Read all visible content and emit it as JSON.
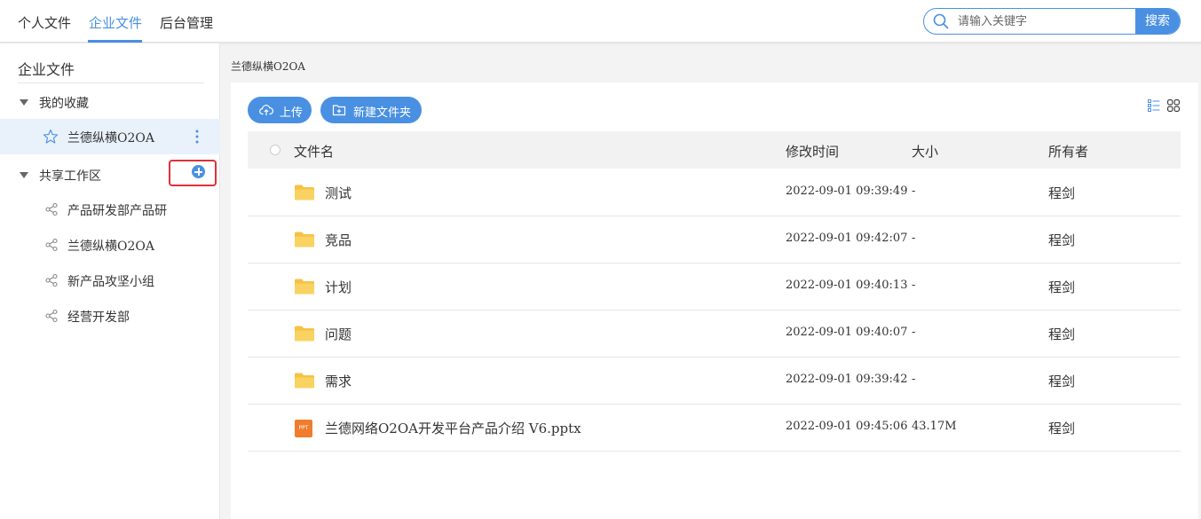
{
  "top_nav": {
    "tabs": [
      {
        "label": "个人文件",
        "active": false
      },
      {
        "label": "企业文件",
        "active": true
      },
      {
        "label": "后台管理",
        "active": false
      }
    ],
    "search": {
      "placeholder": "请输入关键字",
      "value": "",
      "button_label": "搜索"
    },
    "accent_color": "#4a90e2"
  },
  "sidebar": {
    "title": "企业文件",
    "favorites": {
      "label": "我的收藏",
      "items": [
        {
          "label": "兰德纵横O2OA",
          "icon": "star-icon",
          "selected": true
        }
      ]
    },
    "shared": {
      "label": "共享工作区",
      "items": [
        {
          "label": "产品研发部产品研",
          "icon": "share-icon"
        },
        {
          "label": "兰德纵横O2OA",
          "icon": "share-icon"
        },
        {
          "label": "新产品攻坚小组",
          "icon": "share-icon"
        },
        {
          "label": "经营开发部",
          "icon": "share-icon"
        }
      ]
    }
  },
  "main": {
    "breadcrumb": "兰德纵横O2OA",
    "toolbar": {
      "upload_label": "上传",
      "new_folder_label": "新建文件夹"
    },
    "table": {
      "columns": [
        "文件名",
        "修改时间",
        "大小",
        "所有者"
      ],
      "rows": [
        {
          "type": "folder",
          "name": "测试",
          "modified": "2022-09-01 09:39:49",
          "size": "-",
          "owner": "程剑"
        },
        {
          "type": "folder",
          "name": "竞品",
          "modified": "2022-09-01 09:42:07",
          "size": "-",
          "owner": "程剑"
        },
        {
          "type": "folder",
          "name": "计划",
          "modified": "2022-09-01 09:40:13",
          "size": "-",
          "owner": "程剑"
        },
        {
          "type": "folder",
          "name": "问题",
          "modified": "2022-09-01 09:40:07",
          "size": "-",
          "owner": "程剑"
        },
        {
          "type": "folder",
          "name": "需求",
          "modified": "2022-09-01 09:39:42",
          "size": "-",
          "owner": "程剑"
        },
        {
          "type": "ppt",
          "icon_text": "PPT",
          "name": "兰德网络O2OA开发平台产品介绍 V6.pptx",
          "modified": "2022-09-01 09:45:06",
          "size": "43.17M",
          "owner": "程剑"
        }
      ]
    }
  }
}
